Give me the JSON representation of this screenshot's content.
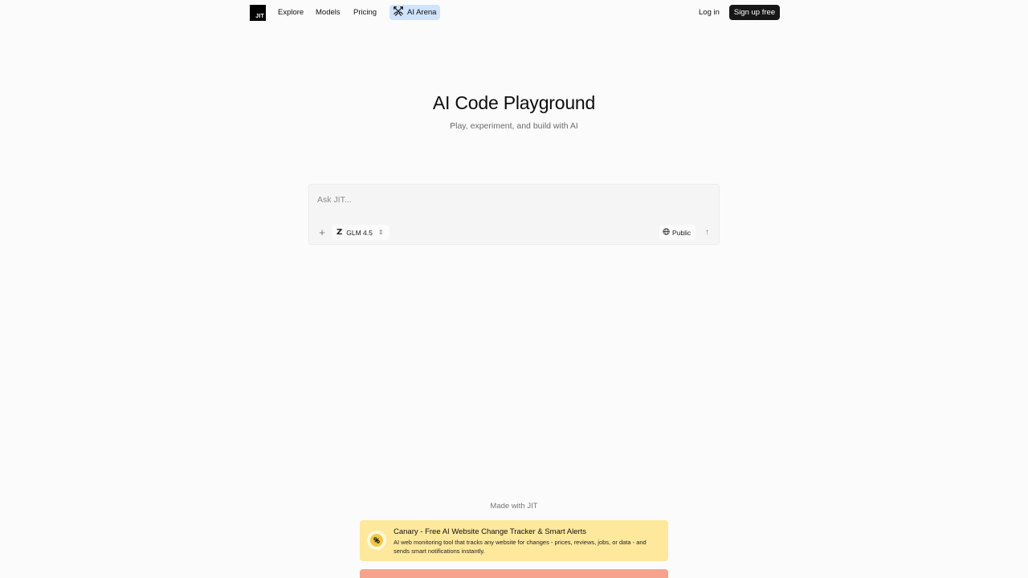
{
  "header": {
    "logo_text": "JIT",
    "nav": [
      "Explore",
      "Models",
      "Pricing"
    ],
    "arena_label": "AI Arena",
    "login_label": "Log in",
    "signup_label": "Sign up free"
  },
  "hero": {
    "title": "AI Code Playground",
    "subtitle": "Play, experiment, and build with AI"
  },
  "prompt": {
    "placeholder": "Ask JIT...",
    "value": "",
    "model_label": "GLM 4.5",
    "visibility_label": "Public"
  },
  "footer": {
    "made_with": "Made with JIT",
    "promo": {
      "title": "Canary - Free AI Website Change Tracker & Smart Alerts",
      "description": "AI web monitoring tool that tracks any website for changes - prices, reviews, jobs, or data - and sends smart notifications instantly."
    }
  },
  "colors": {
    "arena_bg": "#cfe3fb",
    "signup_bg": "#171717",
    "promo_bg": "#fde89c",
    "promo2_bg": "#f6a38d"
  }
}
